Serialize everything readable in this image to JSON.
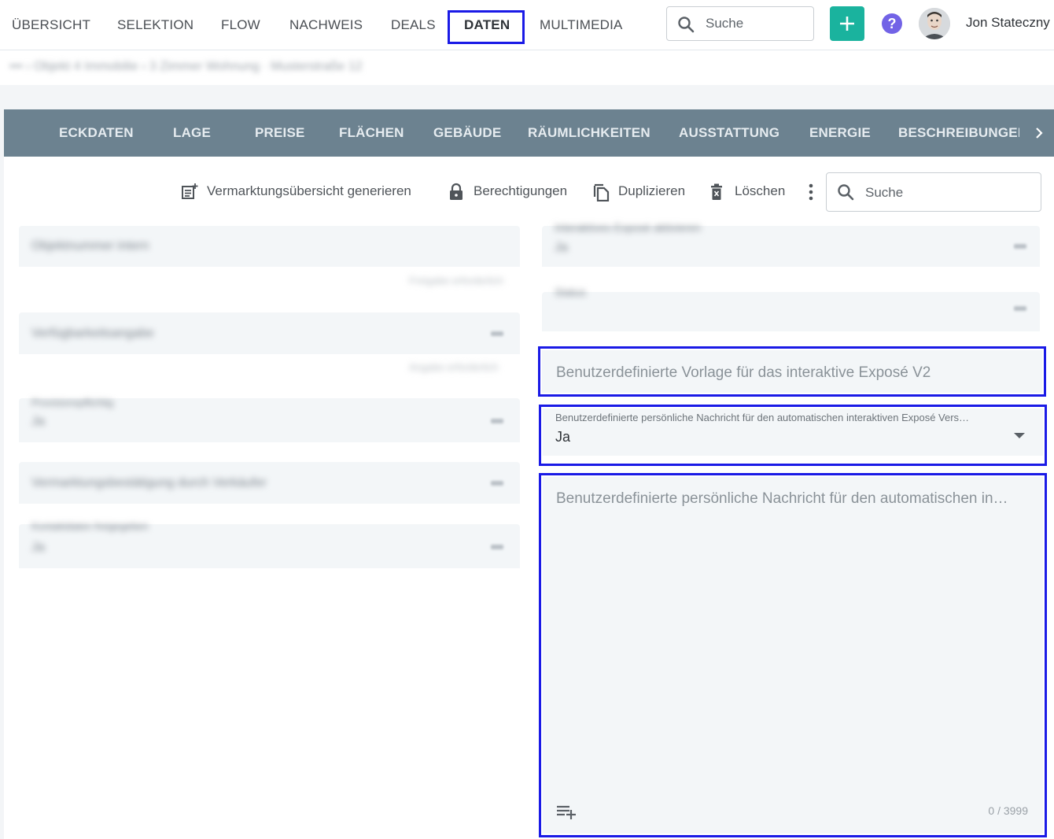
{
  "topnav": {
    "items": [
      {
        "label": "ÜBERSICHT"
      },
      {
        "label": "SELEKTION"
      },
      {
        "label": "FLOW"
      },
      {
        "label": "NACHWEIS"
      },
      {
        "label": "DEALS"
      },
      {
        "label": "DATEN",
        "active": true
      },
      {
        "label": "MULTIMEDIA"
      }
    ],
    "search_placeholder": "Suche",
    "user_name": "Jon Stateczny"
  },
  "breadcrumb": "••• › Objekt 4 Immobilie › 3 Zimmer Wohnung · Musterstraße 12",
  "section_tabs": [
    {
      "label": "ECKDATEN"
    },
    {
      "label": "LAGE"
    },
    {
      "label": "PREISE"
    },
    {
      "label": "FLÄCHEN"
    },
    {
      "label": "GEBÄUDE"
    },
    {
      "label": "RÄUMLICHKEITEN"
    },
    {
      "label": "AUSSTATTUNG"
    },
    {
      "label": "ENERGIE"
    },
    {
      "label": "BESCHREIBUNGEN"
    }
  ],
  "toolbar": {
    "generate_label": "Vermarktungsübersicht generieren",
    "permissions_label": "Berechtigungen",
    "duplicate_label": "Duplizieren",
    "delete_label": "Löschen",
    "search_placeholder": "Suche"
  },
  "left_fields": [
    {
      "value": "Objektnummer intern"
    },
    {
      "value": "Verfügbarkeitsangabe"
    },
    {
      "label": "Provisionspflichtig",
      "value": "Ja"
    },
    {
      "value": "Vermarktungsbestätigung durch Verkäufer"
    },
    {
      "label": "Kontaktdaten freigegeben",
      "value": "Ja"
    }
  ],
  "left_hints": [
    "Freigabe erforderlich",
    "Angabe erforderlich"
  ],
  "right_fields": [
    {
      "label": "Interaktives Exposé aktivieren",
      "value": "Ja"
    },
    {
      "label": "Status"
    }
  ],
  "expose_template": {
    "placeholder": "Benutzerdefinierte Vorlage für das interaktive Exposé V2"
  },
  "personal_message_select": {
    "label": "Benutzerdefinierte persönliche Nachricht für den automatischen interaktiven Exposé Vers…",
    "value": "Ja"
  },
  "personal_message_text": {
    "placeholder": "Benutzerdefinierte persönliche Nachricht für den automatischen in…",
    "counter": "0 / 3999"
  },
  "colors": {
    "accent_green": "#1ab39e",
    "help_purple": "#7263e6",
    "section_bar": "#6c8290",
    "highlight_blue": "#1a1ae6"
  }
}
